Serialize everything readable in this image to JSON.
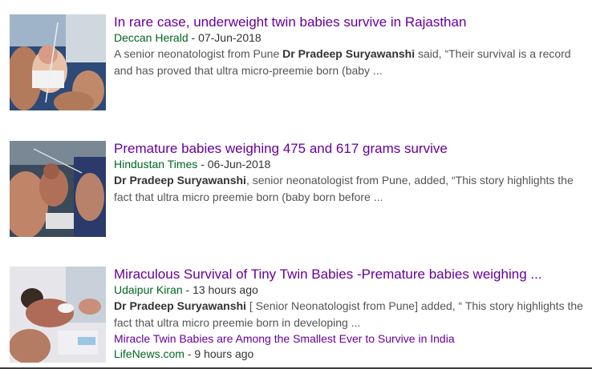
{
  "results": [
    {
      "title": "In rare case, underweight twin babies survive in Rajasthan",
      "source": "Deccan Herald",
      "date": "07-Jun-2018",
      "snippet_pre": "A senior neonatologist from Pune ",
      "snippet_bold": "Dr Pradeep Suryawanshi",
      "snippet_post": " said, “Their survival is a record and has proved that ultra micro-preemie born (baby ...",
      "thumbnail_icon": "premature-baby-in-hands-photo"
    },
    {
      "title": "Premature babies weighing 475 and 617 grams survive",
      "source": "Hindustan Times",
      "date": "06-Jun-2018",
      "snippet_pre": "",
      "snippet_bold": "Dr Pradeep Suryawanshi",
      "snippet_post": ", senior neonatologist from Pune, added, “This story highlights the fact that ultra micro preemie born (baby born before ...",
      "thumbnail_icon": "premature-baby-in-incubator-photo"
    },
    {
      "title": "Miraculous Survival of Tiny Twin Babies -Premature babies weighing ...",
      "source": "Udaipur Kiran",
      "date": "13 hours ago",
      "snippet_pre": "",
      "snippet_bold": "Dr Pradeep Suryawanshi",
      "snippet_post": " [ Senior Neonatologist from Pune] added, “ This story highlights the fact that ultra micro preemie born in developing ...",
      "thumbnail_icon": "newborn-baby-photo",
      "related": {
        "title": "Miracle Twin Babies are Among the Smallest Ever to Survive in India",
        "source": "LifeNews.com",
        "date": "9 hours ago"
      }
    }
  ],
  "separator": " - ",
  "colors": {
    "title": "#660099",
    "source": "#006621",
    "snippet": "#545454",
    "meta": "#333333"
  }
}
